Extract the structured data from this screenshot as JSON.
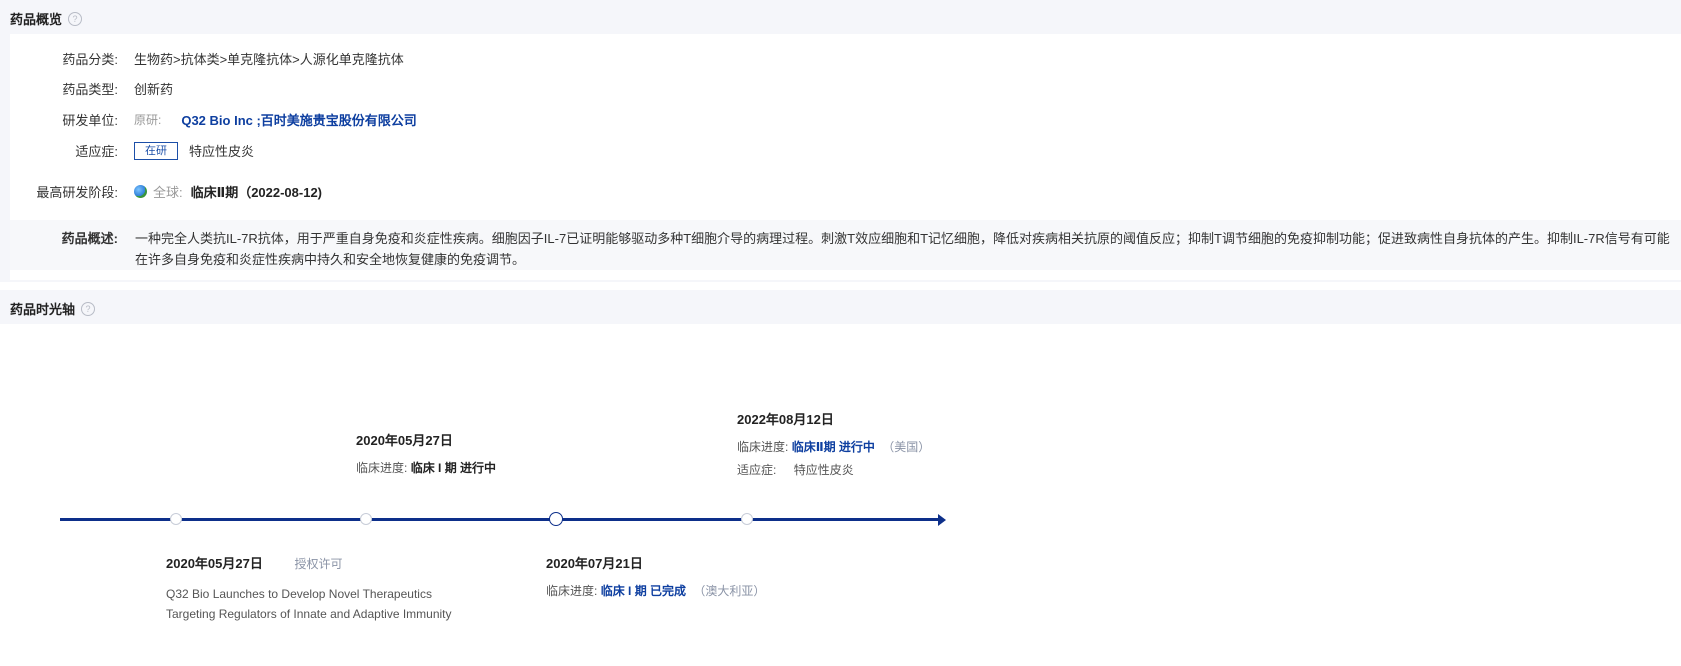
{
  "overview": {
    "title": "药品概览",
    "help": "?",
    "category": {
      "label": "药品分类:",
      "value": "生物药>抗体类>单克隆抗体>人源化单克隆抗体"
    },
    "type": {
      "label": "药品类型:",
      "value": "创新药"
    },
    "developer": {
      "label": "研发单位:",
      "prefix": "原研:",
      "value": "Q32 Bio Inc ;百时美施贵宝股份有限公司"
    },
    "indication": {
      "label": "适应症:",
      "tag": "在研",
      "value": "特应性皮炎"
    },
    "highest_stage": {
      "label": "最高研发阶段:",
      "scope": "全球:",
      "value": "临床Ⅱ期（2022-08-12)"
    },
    "description": {
      "label": "药品概述:",
      "line1": "一种完全人类抗IL-7R抗体，用于严重自身免疫和炎症性疾病。细胞因子IL-7已证明能够驱动多种T细胞介导的病理过程。刺激T效应细胞和T记忆细胞，降低对疾病相关抗原的阈值反应；抑制T调节细胞的免疫抑制功能；促进致病性自身抗体的产生。抑制IL-7R信号有可能",
      "line2": "在许多自身免疫和炎症性疾病中持久和安全地恢复健康的免疫调节。"
    }
  },
  "timeline": {
    "title": "药品时光轴",
    "help": "?",
    "events_top": [
      {
        "date": "2020年05月27日",
        "progress_label": "临床进度:",
        "progress": "临床 I 期 进行中"
      },
      {
        "date": "2022年08月12日",
        "progress_label": "临床进度:",
        "progress": "临床Ⅱ期 进行中",
        "region": "（美国）",
        "indication_label": "适应症:",
        "indication": "特应性皮炎"
      }
    ],
    "events_bottom": [
      {
        "date": "2020年05月27日",
        "tag": "授权许可",
        "news_line1": "Q32 Bio Launches to Develop Novel Therapeutics",
        "news_line2": "Targeting Regulators of Innate and Adaptive Immunity"
      },
      {
        "date": "2020年07月21日",
        "progress_label": "临床进度:",
        "progress": "临床 I 期 已完成",
        "region": "（澳大利亚）"
      }
    ]
  },
  "colors": {
    "accent": "#0d2f8a",
    "link": "#0e3fa0",
    "panel_bg": "#f5f6fa"
  }
}
